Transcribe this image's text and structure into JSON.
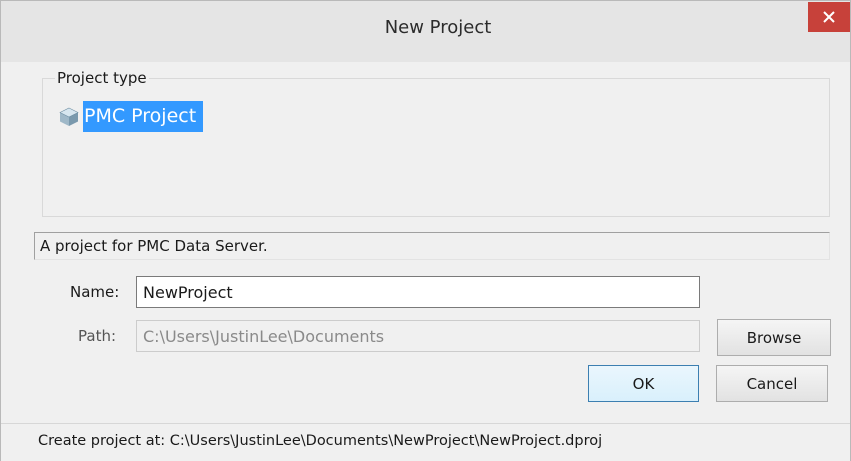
{
  "window": {
    "title": "New Project",
    "close_icon": "close-icon"
  },
  "project_type": {
    "group_label": "Project type",
    "items": [
      {
        "label": "PMC Project",
        "icon": "project-cube-icon",
        "selected": true
      }
    ]
  },
  "description": "A project for PMC Data Server.",
  "form": {
    "name_label": "Name:",
    "name_value": "NewProject",
    "path_label": "Path:",
    "path_value": "C:\\Users\\JustinLee\\Documents",
    "path_enabled": false
  },
  "buttons": {
    "browse": "Browse",
    "ok": "OK",
    "cancel": "Cancel"
  },
  "status": "Create project at: C:\\Users\\JustinLee\\Documents\\NewProject\\NewProject.dproj",
  "colors": {
    "selection": "#3399ff",
    "close_button": "#c7413a",
    "default_button_border": "#3c7fb1"
  }
}
